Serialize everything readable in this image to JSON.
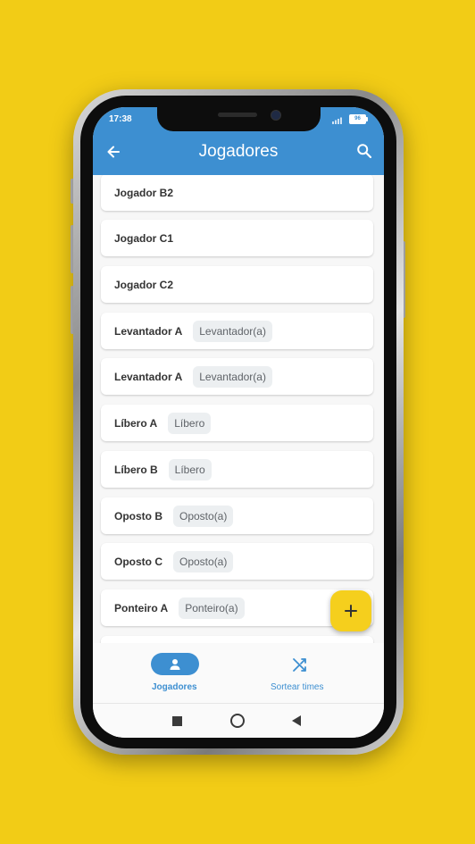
{
  "status_bar": {
    "time": "17:38",
    "battery": "96"
  },
  "app_bar": {
    "title": "Jogadores"
  },
  "players": [
    {
      "name": "Jogador B2",
      "position": ""
    },
    {
      "name": "Jogador C1",
      "position": ""
    },
    {
      "name": "Jogador C2",
      "position": ""
    },
    {
      "name": "Levantador A",
      "position": "Levantador(a)"
    },
    {
      "name": "Levantador A",
      "position": "Levantador(a)"
    },
    {
      "name": "Líbero A",
      "position": "Líbero"
    },
    {
      "name": "Líbero B",
      "position": "Líbero"
    },
    {
      "name": "Oposto B",
      "position": "Oposto(a)"
    },
    {
      "name": "Oposto C",
      "position": "Oposto(a)"
    },
    {
      "name": "Ponteiro A",
      "position": "Ponteiro(a)"
    }
  ],
  "bottom_nav": {
    "items": [
      {
        "label": "Jogadores",
        "icon": "person-icon",
        "selected": true
      },
      {
        "label": "Sortear times",
        "icon": "shuffle-icon",
        "selected": false
      }
    ]
  },
  "colors": {
    "background": "#f2cc16",
    "primary": "#3d8fd1",
    "fab": "#f5cf1d"
  }
}
